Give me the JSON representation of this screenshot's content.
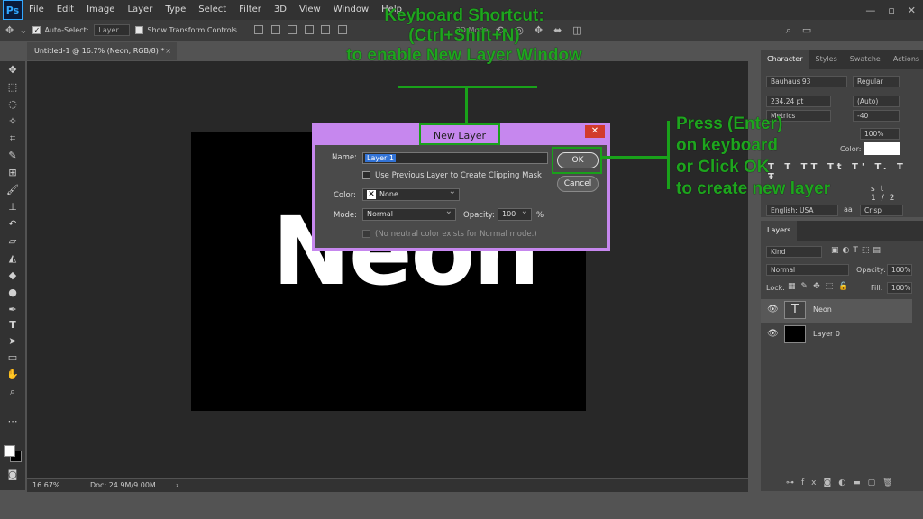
{
  "app": {
    "logo": "Ps",
    "menu": [
      "File",
      "Edit",
      "Image",
      "Layer",
      "Type",
      "Select",
      "Filter",
      "3D",
      "View",
      "Window",
      "Help"
    ],
    "window_controls": [
      "—",
      "▫",
      "✕"
    ]
  },
  "options_bar": {
    "auto_select_label": "Auto-Select:",
    "auto_select_value": "Layer",
    "transform_label": "Show Transform Controls",
    "mode_3d_label": "3D Mode:"
  },
  "document_tab": {
    "title": "Untitled-1 @ 16.7% (Neon, RGB/8) *",
    "close": "×"
  },
  "canvas": {
    "text": "Neon"
  },
  "status_bar": {
    "zoom": "16.67%",
    "doc": "Doc: 24.9M/9.00M",
    "arrow": "›"
  },
  "character_panel": {
    "tabs": [
      "Character",
      "Styles",
      "Swatche",
      "Actions"
    ],
    "font_family": "Bauhaus 93",
    "font_style": "Regular",
    "font_size": "234.24 pt",
    "leading": "(Auto)",
    "kerning": "Metrics",
    "tracking": "-40",
    "scale": "100%",
    "color_label": "Color:",
    "type_buttons": [
      "T",
      "T",
      "TT",
      "Tt",
      "T'",
      "T.",
      "T",
      "Ŧ"
    ],
    "opentype_buttons": [
      "st",
      "1/2"
    ],
    "language": "English: USA",
    "aa_icon": "aa",
    "aa": "Crisp"
  },
  "layers_panel": {
    "tab": "Layers",
    "filter": "Kind",
    "blend": "Normal",
    "opacity_label": "Opacity:",
    "opacity": "100%",
    "lock_label": "Lock:",
    "fill_label": "Fill:",
    "fill": "100%",
    "layers": [
      {
        "name": "Neon",
        "thumb": "T"
      },
      {
        "name": "Layer 0",
        "thumb": ""
      }
    ]
  },
  "dialog": {
    "title": "New Layer",
    "close": "✕",
    "name_label": "Name:",
    "name_value": "Layer 1",
    "clip_label": "Use Previous Layer to Create Clipping Mask",
    "color_label": "Color:",
    "color_value": "None",
    "mode_label": "Mode:",
    "mode_value": "Normal",
    "opacity_label": "Opacity:",
    "opacity_value": "100",
    "opacity_unit": "%",
    "neutral_note": "(No neutral color exists for Normal mode.)",
    "ok": "OK",
    "cancel": "Cancel"
  },
  "annotations": {
    "top_line1": "Keyboard Shortcut:",
    "top_line2": "(Ctrl+Shift+N)",
    "top_line3": "to enable New Layer Window",
    "right_line1": "Press (Enter)",
    "right_line2": "on keyboard",
    "right_line3": "or Click OK",
    "right_line4": "to create new layer",
    "color": "#1ea51e"
  },
  "colors": {
    "dialog_border": "#c687ee",
    "highlight_green": "#19a11a",
    "close_red": "#d23b2c"
  }
}
